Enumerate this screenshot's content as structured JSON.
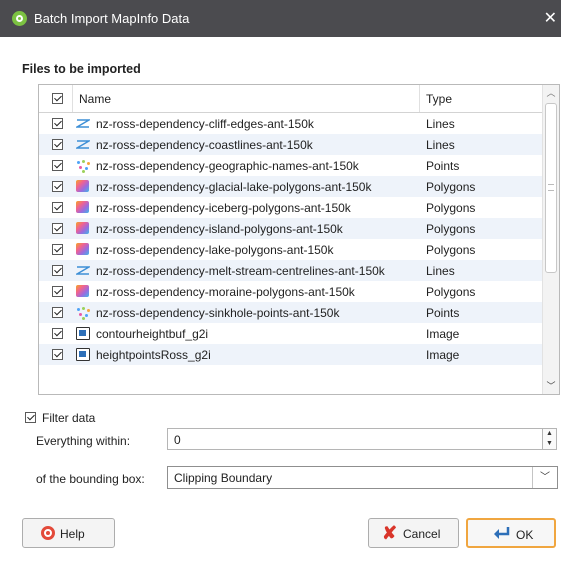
{
  "window": {
    "title": "Batch Import MapInfo Data",
    "close_glyph": "✕"
  },
  "files_section": {
    "label": "Files to be imported"
  },
  "table": {
    "columns": {
      "name": "Name",
      "type": "Type"
    },
    "rows": [
      {
        "name": "nz-ross-dependency-cliff-edges-ant-150k",
        "type": "Lines",
        "icon": "lines-icon",
        "checked": true
      },
      {
        "name": "nz-ross-dependency-coastlines-ant-150k",
        "type": "Lines",
        "icon": "lines-icon",
        "checked": true
      },
      {
        "name": "nz-ross-dependency-geographic-names-ant-150k",
        "type": "Points",
        "icon": "points-icon",
        "checked": true
      },
      {
        "name": "nz-ross-dependency-glacial-lake-polygons-ant-150k",
        "type": "Polygons",
        "icon": "polygons-icon",
        "checked": true
      },
      {
        "name": "nz-ross-dependency-iceberg-polygons-ant-150k",
        "type": "Polygons",
        "icon": "polygons-icon",
        "checked": true
      },
      {
        "name": "nz-ross-dependency-island-polygons-ant-150k",
        "type": "Polygons",
        "icon": "polygons-icon",
        "checked": true
      },
      {
        "name": "nz-ross-dependency-lake-polygons-ant-150k",
        "type": "Polygons",
        "icon": "polygons-icon",
        "checked": true
      },
      {
        "name": "nz-ross-dependency-melt-stream-centrelines-ant-150k",
        "type": "Lines",
        "icon": "lines-icon",
        "checked": true
      },
      {
        "name": "nz-ross-dependency-moraine-polygons-ant-150k",
        "type": "Polygons",
        "icon": "polygons-icon",
        "checked": true
      },
      {
        "name": "nz-ross-dependency-sinkhole-points-ant-150k",
        "type": "Points",
        "icon": "points-icon",
        "checked": true
      },
      {
        "name": "contourheightbuf_g2i",
        "type": "Image",
        "icon": "image-icon",
        "checked": true
      },
      {
        "name": "heightpointsRoss_g2i",
        "type": "Image",
        "icon": "image-icon",
        "checked": true
      }
    ]
  },
  "filter": {
    "checkbox_label": "Filter data",
    "checked": true,
    "within_label": "Everything within:",
    "within_value": "0",
    "bbox_label": "of the bounding box:",
    "bbox_value": "Clipping Boundary"
  },
  "buttons": {
    "help": "Help",
    "cancel": "Cancel",
    "ok": "OK"
  },
  "colors": {
    "titlebar": "#4b4b4f",
    "row_alt": "#eef3fa",
    "ok_border": "#f0a640"
  }
}
